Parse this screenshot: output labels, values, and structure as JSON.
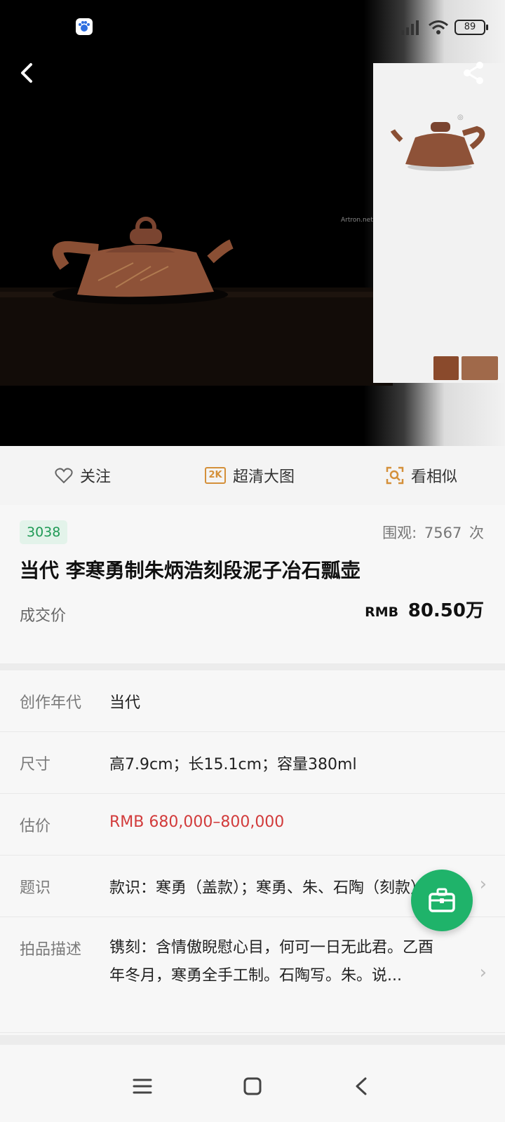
{
  "status_bar": {
    "app_icon": "baidu-paw-icon",
    "signal_icon": "signal-icon",
    "wifi_icon": "wifi-icon",
    "battery": "89"
  },
  "hero": {
    "back_icon": "back-chevron-icon",
    "share_icon": "share-icon",
    "watermark": "Artron.net"
  },
  "actions": {
    "follow_label": "关注",
    "follow_icon": "heart-outline-icon",
    "hd_badge": "2K",
    "hd_label": "超清大图",
    "similar_label": "看相似",
    "similar_icon": "image-search-icon"
  },
  "lot": {
    "number": "3038",
    "views_label": "围观:",
    "views_count": "7567",
    "views_unit": "次",
    "title": "当代 李寒勇制朱炳浩刻段泥子冶石瓢壶",
    "price_label": "成交价",
    "price_currency": "RMB",
    "price_value": "80.50万"
  },
  "details": [
    {
      "label": "创作年代",
      "value": "当代"
    },
    {
      "label": "尺寸",
      "value": "高7.9cm；长15.1cm；容量380ml"
    },
    {
      "label": "估价",
      "value": "RMB  680,000–800,000"
    },
    {
      "label": "题识",
      "value": "款识：寒勇（盖款）；寒勇、朱、石陶（刻款）"
    },
    {
      "label": "拍品描述",
      "value": "镌刻：含情傲睨慰心目，何可一日无此君。乙酉年冬月，寒勇全手工制。石陶写。朱。说..."
    }
  ],
  "colors": {
    "accent_green": "#1fb36a",
    "estimate_red": "#d23b3b",
    "badge_green": "#1f9a55",
    "hd_orange": "#d4903a"
  },
  "fab_icon": "toolbox-icon",
  "navbar": {
    "menu_icon": "menu-icon",
    "home_icon": "home-square-icon",
    "back_icon": "nav-back-icon"
  }
}
